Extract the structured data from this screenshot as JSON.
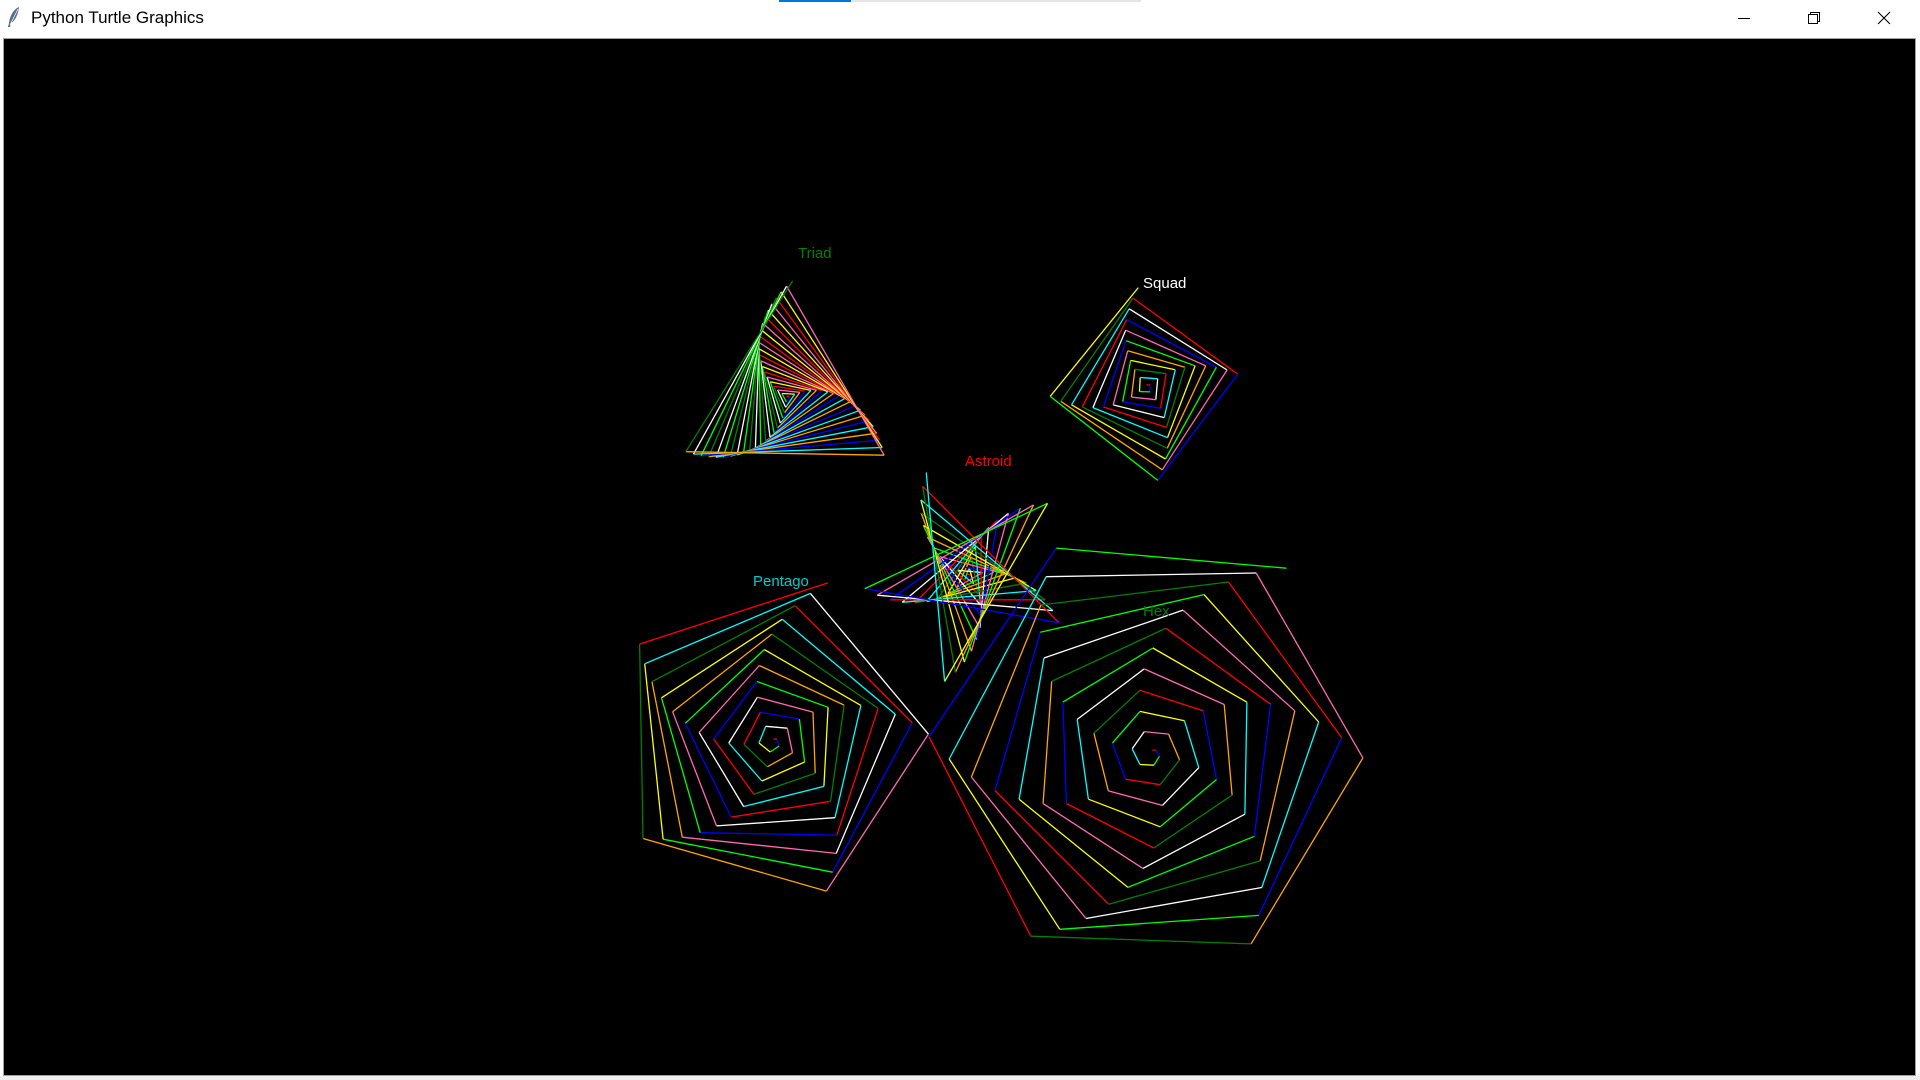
{
  "window": {
    "title": "Python Turtle Graphics",
    "controls": {
      "minimize_icon": "minimize-icon",
      "restore_icon": "restore-icon",
      "close_icon": "close-icon"
    }
  },
  "canvas": {
    "background": "#000000",
    "palette": [
      "#ff0000",
      "#0000ff",
      "#00ff00",
      "#ffff00",
      "#00ffff",
      "#ffffff",
      "#ff69b4",
      "#ffa500",
      "#008000"
    ],
    "shapes": [
      {
        "name": "Triad",
        "sides": 3,
        "label_color": "#008000"
      },
      {
        "name": "Squad",
        "sides": 4,
        "label_color": "#ffffff"
      },
      {
        "name": "Astroid",
        "sides": 5,
        "label_color": "#ff0000"
      },
      {
        "name": "Pentago",
        "sides": 5,
        "label_color": "#00cccc"
      },
      {
        "name": "Hex",
        "sides": 6,
        "label_color": "#008000"
      }
    ]
  }
}
